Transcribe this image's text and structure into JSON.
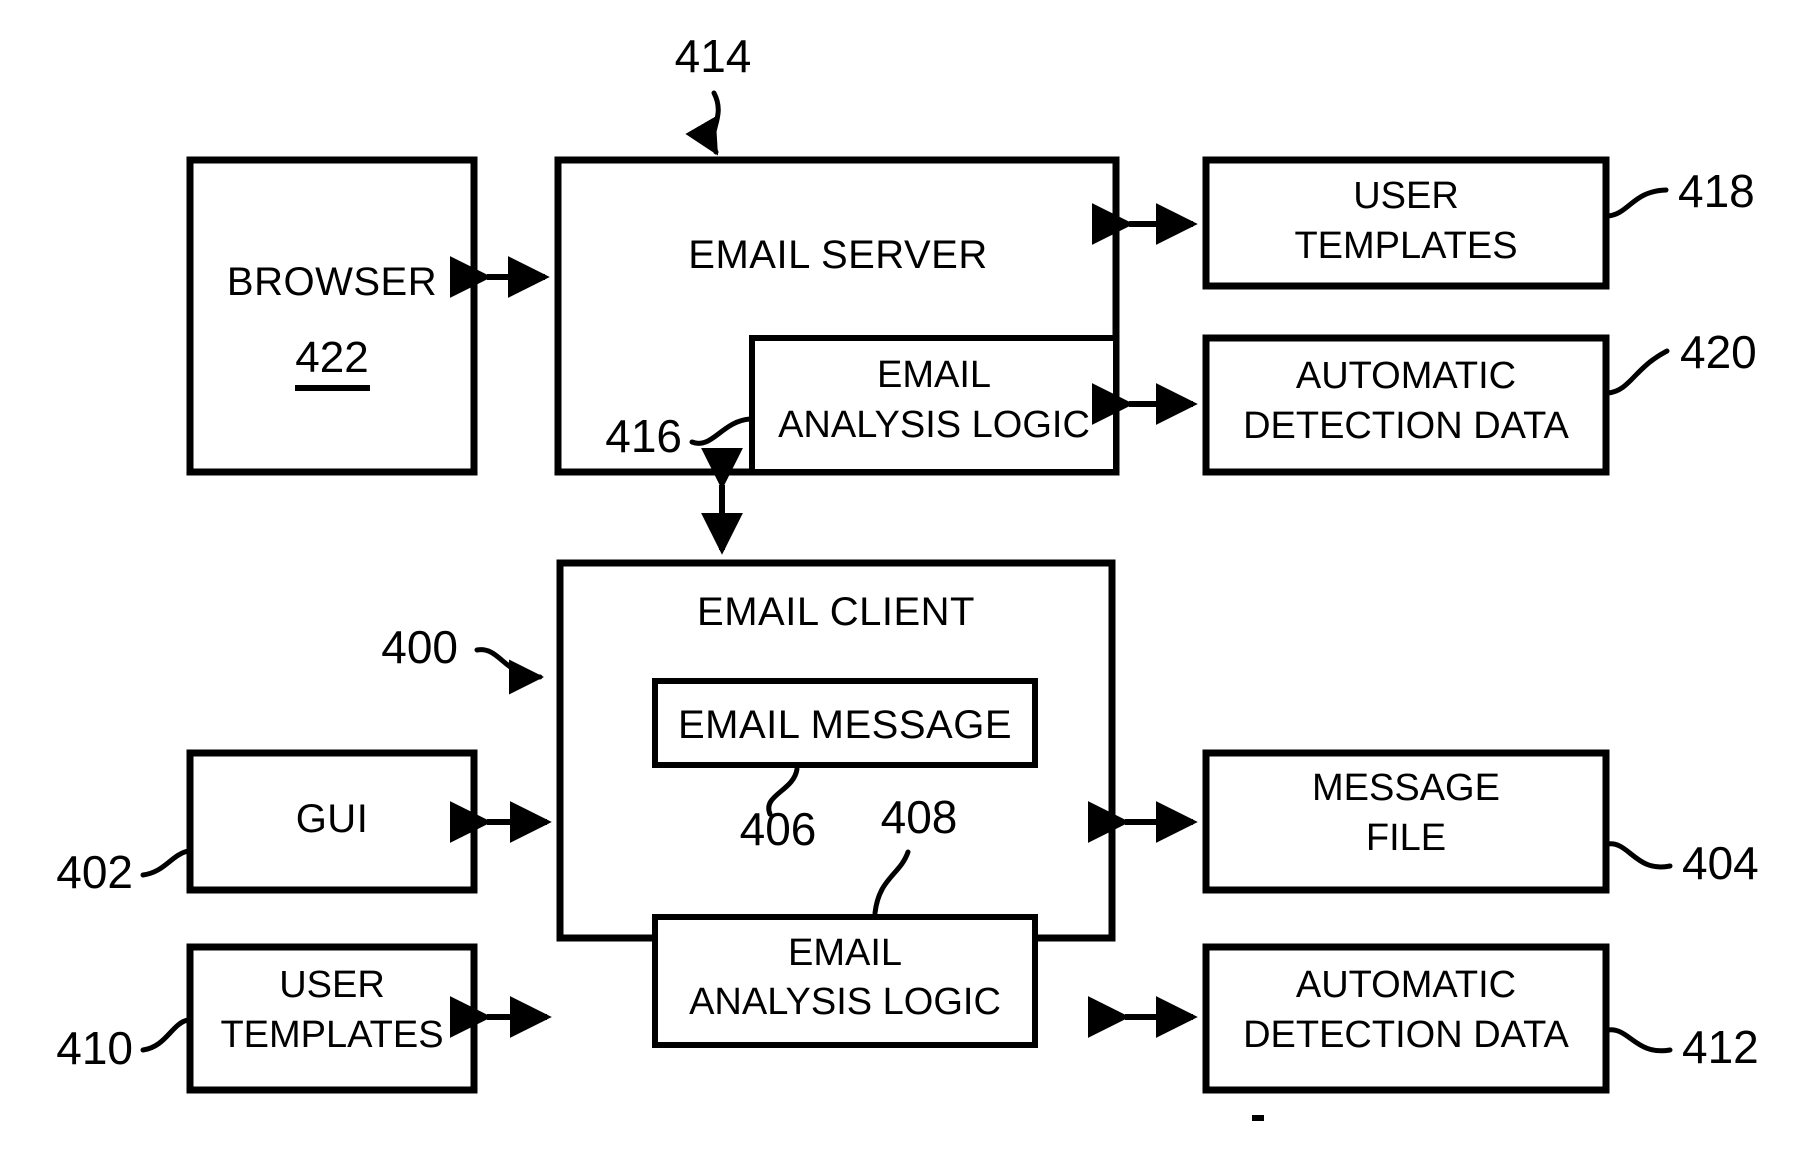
{
  "figure": {
    "type": "patent-block-diagram",
    "background_color": "#ffffff",
    "line_color": "#000000"
  },
  "blocks": {
    "browser": {
      "label": "BROWSER",
      "ref": "422"
    },
    "email_server": {
      "label": "EMAIL SERVER",
      "ref": "414"
    },
    "server_analysis_logic": {
      "line1": "EMAIL",
      "line2": "ANALYSIS LOGIC",
      "ref": "416"
    },
    "user_templates_server": {
      "line1": "USER",
      "line2": "TEMPLATES",
      "ref": "418"
    },
    "auto_detection_server": {
      "line1": "AUTOMATIC",
      "line2": "DETECTION DATA",
      "ref": "420"
    },
    "email_client": {
      "label": "EMAIL CLIENT",
      "ref": "400"
    },
    "email_message": {
      "label": "EMAIL MESSAGE",
      "ref": "406"
    },
    "client_analysis_logic": {
      "line1": "EMAIL",
      "line2": "ANALYSIS LOGIC",
      "ref": "408"
    },
    "gui": {
      "label": "GUI",
      "ref": "402"
    },
    "user_templates_client": {
      "line1": "USER",
      "line2": "TEMPLATES",
      "ref": "410"
    },
    "message_file": {
      "line1": "MESSAGE",
      "line2": "FILE",
      "ref": "404"
    },
    "auto_detection_client": {
      "line1": "AUTOMATIC",
      "line2": "DETECTION DATA",
      "ref": "412"
    }
  },
  "connectors": [
    {
      "name": "browser-to-server",
      "style": "double-arrow",
      "orientation": "horizontal"
    },
    {
      "name": "server-to-user-templates",
      "style": "double-arrow",
      "orientation": "horizontal"
    },
    {
      "name": "server-logic-to-auto-detection",
      "style": "double-arrow",
      "orientation": "horizontal"
    },
    {
      "name": "server-logic-to-client",
      "style": "double-arrow",
      "orientation": "vertical"
    },
    {
      "name": "gui-to-client",
      "style": "double-arrow",
      "orientation": "horizontal"
    },
    {
      "name": "user-templates-to-client",
      "style": "double-arrow",
      "orientation": "horizontal"
    },
    {
      "name": "client-to-message-file",
      "style": "double-arrow",
      "orientation": "horizontal"
    },
    {
      "name": "client-to-auto-detection",
      "style": "double-arrow",
      "orientation": "horizontal"
    }
  ]
}
